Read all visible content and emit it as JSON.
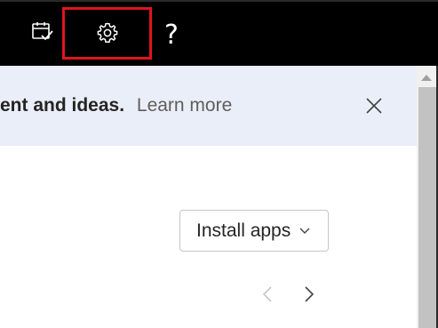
{
  "topbar": {
    "calendar_icon": "calendar-check-icon",
    "settings_icon": "gear-icon",
    "help_label": "?"
  },
  "banner": {
    "text_bold": "ent and ideas.",
    "link_label": "Learn more",
    "close_icon": "close-icon"
  },
  "content": {
    "install_label": "Install apps",
    "prev_icon": "chevron-left-icon",
    "next_icon": "chevron-right-icon"
  },
  "colors": {
    "topbar_bg": "#000000",
    "banner_bg": "#eaeef8",
    "highlight": "#e0141e"
  }
}
